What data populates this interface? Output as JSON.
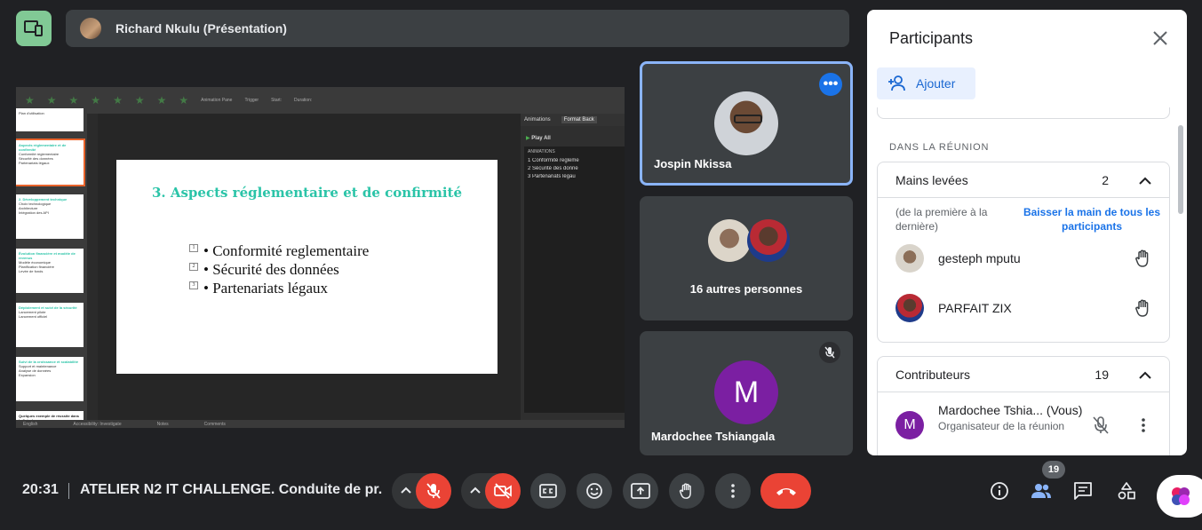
{
  "presenter": {
    "name": "Richard Nkulu (Présentation)"
  },
  "slide": {
    "title": "3. Aspects réglementaire et de confirmité",
    "bullets": [
      {
        "num": "1",
        "text": "• Conformité reglementaire"
      },
      {
        "num": "2",
        "text": "• Sécurité des données"
      },
      {
        "num": "3",
        "text": "• Partenariats légaux"
      }
    ]
  },
  "editor": {
    "ribbon": [
      "Animation Pane",
      "Trigger",
      "Start:",
      "Duration:"
    ],
    "pane_tabs": [
      "Animations",
      "Format Back"
    ],
    "play_all": "Play All",
    "anim_header": "ANIMATIONS",
    "anim_items": [
      "1  Conformité regleme",
      "2  Sécurité des donné",
      "3  Partenariats légau"
    ],
    "status": [
      "English",
      "Accessibility: Investigate",
      "Notes",
      "Comments"
    ],
    "thumbs": [
      {
        "title": "",
        "lines": [
          "Plan d'utilisation"
        ]
      },
      {
        "title": "Aspects réglementaire et de confirmité",
        "lines": [
          "Conformité reglementaire",
          "Sécurité des données",
          "Partenariats légaux"
        ]
      },
      {
        "title": "2. Développement technique",
        "lines": [
          "Choix technologique",
          "Architecture",
          "Intégration des API"
        ]
      },
      {
        "title": "Évolution financière et modèle de revenus",
        "lines": [
          "Modèle économique",
          "Planification financière",
          "Levée de fonds"
        ]
      },
      {
        "title": "Déploiement et suivi de la sécurité",
        "lines": [
          "Lancement pilote",
          "Lancement officiel"
        ]
      },
      {
        "title": "Suivi de la croissance et scalabilité",
        "lines": [
          "Support et maintenance",
          "Analyse de données",
          "Expansion"
        ]
      },
      {
        "title": "Quelques exemple de réussite dans la fintech",
        "lines": []
      }
    ]
  },
  "tiles": {
    "speaker": {
      "name": "Jospin Nkissa"
    },
    "others": {
      "label": "16 autres personnes"
    },
    "self": {
      "name": "Mardochee Tshiangala",
      "initial": "M"
    }
  },
  "panel": {
    "title": "Participants",
    "add_label": "Ajouter",
    "section": "DANS LA RÉUNION",
    "raised": {
      "label": "Mains levées",
      "count": "2",
      "hint": "(de la première à la dernière)",
      "lower_all": "Baisser la main de tous les participants",
      "people": [
        "gesteph mputu",
        "PARFAIT ZIX"
      ]
    },
    "contrib": {
      "label": "Contributeurs",
      "count": "19",
      "person": {
        "name": "Mardochee Tshia... (Vous)",
        "role": "Organisateur de la réunion",
        "initial": "M"
      }
    }
  },
  "bottom": {
    "time": "20:31",
    "meeting": "ATELIER N2 IT CHALLENGE. Conduite de pr...",
    "people_count": "19"
  },
  "colors": {
    "accent": "#1a73e8",
    "leave": "#ea4335",
    "slide_title": "#2bc4a8",
    "speaker_border": "#8ab4f8"
  }
}
